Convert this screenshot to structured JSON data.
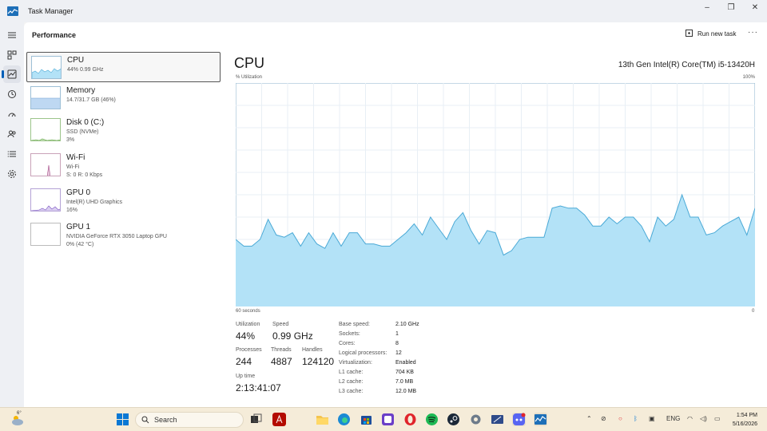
{
  "window": {
    "title": "Task Manager",
    "minimize": "–",
    "maximize": "❐",
    "close": "✕"
  },
  "header": {
    "title": "Performance",
    "run_new_task": "Run new task",
    "more": "···"
  },
  "devices": [
    {
      "name": "CPU",
      "sub1": "44% 0.99 GHz",
      "sub2": ""
    },
    {
      "name": "Memory",
      "sub1": "14.7/31.7 GB (46%)",
      "sub2": ""
    },
    {
      "name": "Disk 0 (C:)",
      "sub1": "SSD (NVMe)",
      "sub2": "3%"
    },
    {
      "name": "Wi-Fi",
      "sub1": "Wi-Fi",
      "sub2": "S: 0 R: 0 Kbps"
    },
    {
      "name": "GPU 0",
      "sub1": "Intel(R) UHD Graphics",
      "sub2": "16%"
    },
    {
      "name": "GPU 1",
      "sub1": "NVIDIA GeForce RTX 3050 Laptop GPU",
      "sub2": "0% (42 °C)"
    }
  ],
  "cpu": {
    "title": "CPU",
    "model": "13th Gen Intel(R) Core(TM) i5-13420H",
    "util_label": "% Utilization",
    "max_label": "100%",
    "time_label": "60 seconds",
    "min_label": "0",
    "stats": {
      "utilization_label": "Utilization",
      "utilization": "44%",
      "speed_label": "Speed",
      "speed": "0.99 GHz",
      "processes_label": "Processes",
      "processes": "244",
      "threads_label": "Threads",
      "threads": "4887",
      "handles_label": "Handles",
      "handles": "124120",
      "uptime_label": "Up time",
      "uptime": "2:13:41:07"
    },
    "details": [
      {
        "k": "Base speed:",
        "v": "2.10 GHz"
      },
      {
        "k": "Sockets:",
        "v": "1"
      },
      {
        "k": "Cores:",
        "v": "8"
      },
      {
        "k": "Logical processors:",
        "v": "12"
      },
      {
        "k": "Virtualization:",
        "v": "Enabled"
      },
      {
        "k": "L1 cache:",
        "v": "704 KB"
      },
      {
        "k": "L2 cache:",
        "v": "7.0 MB"
      },
      {
        "k": "L3 cache:",
        "v": "12.0 MB"
      }
    ]
  },
  "chart_data": {
    "type": "area",
    "ylim": [
      0,
      100
    ],
    "values": [
      30,
      27,
      27,
      30,
      39,
      32,
      31,
      33,
      27,
      33,
      28,
      26,
      33,
      27,
      33,
      33,
      28,
      28,
      27,
      27,
      30,
      33,
      37,
      32,
      40,
      35,
      30,
      38,
      42,
      34,
      28,
      34,
      33,
      23,
      25,
      30,
      31,
      31,
      31,
      44,
      45,
      44,
      44,
      41,
      36,
      36,
      40,
      37,
      40,
      40,
      36,
      29,
      40,
      36,
      39,
      50,
      40,
      40,
      32,
      33,
      36,
      38,
      40,
      32,
      44
    ],
    "color": "#b3e2f7",
    "line_color": "#4aa9d6"
  },
  "taskbar": {
    "weather_temp": "6°",
    "search_placeholder": "Search",
    "lang": "ENG",
    "time": "1:54 PM",
    "date": "5/16/2026"
  }
}
